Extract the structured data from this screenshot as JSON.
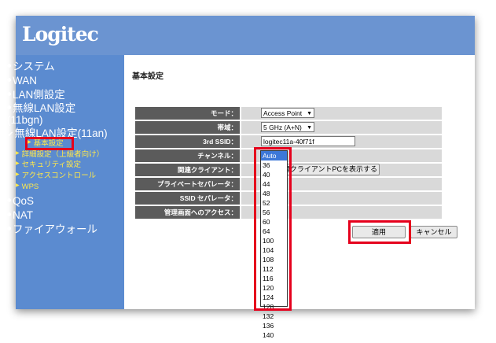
{
  "brand": {
    "logo_text": "Logitec"
  },
  "sidebar": {
    "items": [
      {
        "label": "システム"
      },
      {
        "label": "WAN"
      },
      {
        "label": "LAN側設定"
      },
      {
        "label": "無線LAN設定",
        "label_line2": "(11bgn)"
      },
      {
        "label": "無線LAN設定(11an)",
        "active": true
      },
      {
        "label": "QoS"
      },
      {
        "label": "NAT"
      },
      {
        "label": "ファイアウォール"
      }
    ],
    "sub_items": [
      {
        "label": "基本設定",
        "selected": true
      },
      {
        "label": "詳細設定（上級者向け）"
      },
      {
        "label": "セキュリティ設定"
      },
      {
        "label": "アクセスコントロール"
      },
      {
        "label": "WPS"
      }
    ]
  },
  "main": {
    "title": "基本設定",
    "rows": {
      "mode": {
        "label": "モード：",
        "value": "Access Point"
      },
      "band": {
        "label": "帯域：",
        "value": "5 GHz (A+N)"
      },
      "ssid": {
        "label": "3rd SSID：",
        "value": "logitec11a-40f71f"
      },
      "channel": {
        "label": "チャンネル："
      },
      "client": {
        "label": "関連クライアント：",
        "button": "関連クライアントPCを表示する"
      },
      "private": {
        "label": "プライベートセパレータ："
      },
      "ssid_sep": {
        "label": "SSID セパレータ："
      },
      "admin": {
        "label": "管理画面へのアクセス："
      }
    },
    "buttons": {
      "apply": "適用",
      "cancel": "キャンセル"
    }
  },
  "channel_options": [
    "Auto",
    "36",
    "40",
    "44",
    "48",
    "52",
    "56",
    "60",
    "64",
    "100",
    "104",
    "108",
    "112",
    "116",
    "120",
    "124",
    "128",
    "132",
    "136",
    "140"
  ],
  "channel_selected": "Auto",
  "colors": {
    "highlight": "#e5001c",
    "sidebar": "#5b8bd0",
    "header": "#6b94d1",
    "submenu_text": "#ffe84a"
  }
}
